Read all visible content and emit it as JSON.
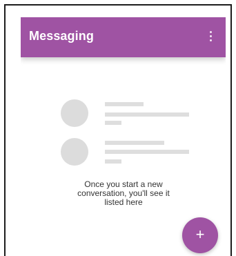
{
  "app_bar": {
    "title": "Messaging",
    "overflow_icon": "more-vert-icon",
    "color": "#9f53a3"
  },
  "empty_state": {
    "lines": [
      "Once you start a new",
      "conversation, you'll see it",
      "listed here"
    ]
  },
  "fab": {
    "icon": "plus-icon",
    "label": "+",
    "color": "#9f53a3"
  }
}
